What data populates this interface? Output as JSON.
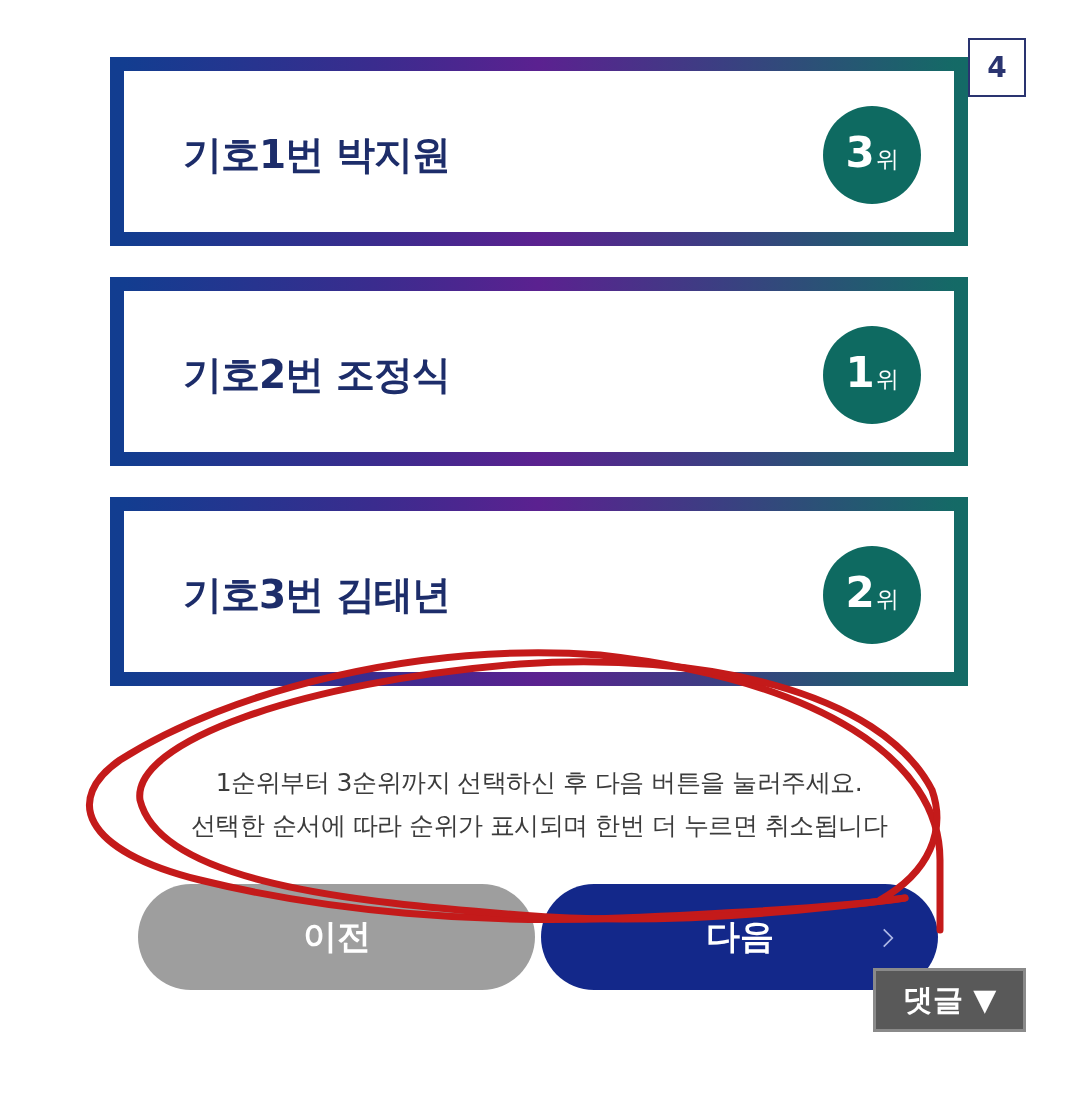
{
  "page_badge": "4",
  "candidates": [
    {
      "name": "기호1번 박지원",
      "selected": true,
      "rank": "3",
      "rank_suffix": "위"
    },
    {
      "name": "기호2번 조정식",
      "selected": true,
      "rank": "1",
      "rank_suffix": "위"
    },
    {
      "name": "기호3번 김태년",
      "selected": true,
      "rank": "2",
      "rank_suffix": "위"
    }
  ],
  "instructions": [
    "1순위부터 3순위까지 선택하신 후 다음 버튼을 눌러주세요.",
    "선택한 순서에 따라 순위가 표시되며 한번 더 누르면 취소됩니다"
  ],
  "buttons": [
    {
      "kind": "prev",
      "label": "이전"
    },
    {
      "kind": "next",
      "label": "다음"
    }
  ],
  "comment_button": {
    "label": "댓글 ▼"
  }
}
